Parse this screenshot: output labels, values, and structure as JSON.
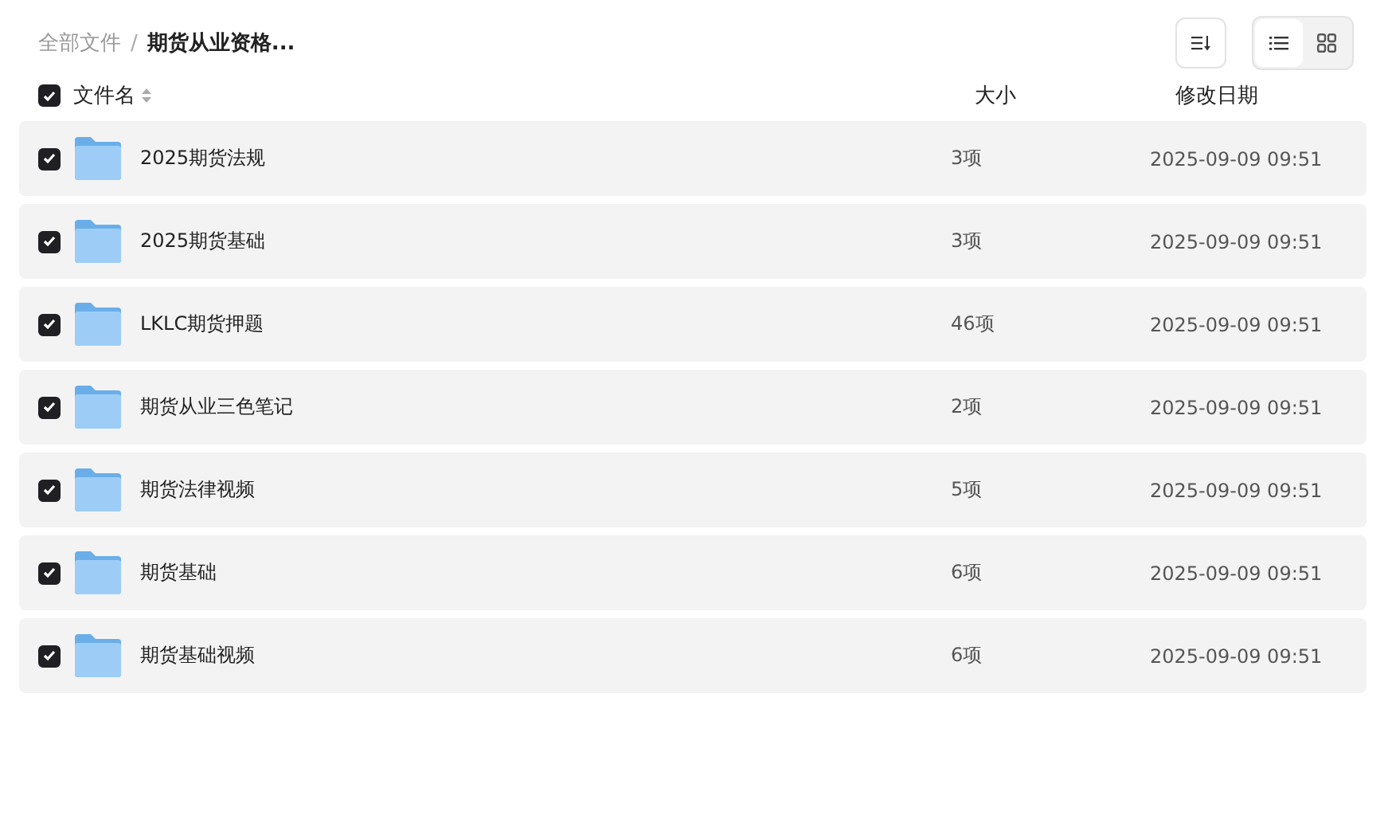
{
  "breadcrumb": [
    {
      "label": "全部文件",
      "current": false
    },
    {
      "label": "期货从业资格...",
      "current": true
    }
  ],
  "breadcrumb_separator": "/",
  "view_modes": [
    {
      "kind": "list",
      "selected": true
    },
    {
      "kind": "grid",
      "selected": false
    }
  ],
  "header": {
    "checked": true,
    "columns": [
      "文件名",
      "大小",
      "修改日期"
    ]
  },
  "rows": [
    {
      "name": "2025期货法规",
      "size": "3项",
      "modified": "2025-09-09 09:51",
      "checked": true
    },
    {
      "name": "2025期货基础",
      "size": "3项",
      "modified": "2025-09-09 09:51",
      "checked": true
    },
    {
      "name": "LKLC期货押题",
      "size": "46项",
      "modified": "2025-09-09 09:51",
      "checked": true
    },
    {
      "name": "期货从业三色笔记",
      "size": "2项",
      "modified": "2025-09-09 09:51",
      "checked": true
    },
    {
      "name": "期货法律视频",
      "size": "5项",
      "modified": "2025-09-09 09:51",
      "checked": true
    },
    {
      "name": "期货基础",
      "size": "6项",
      "modified": "2025-09-09 09:51",
      "checked": true
    },
    {
      "name": "期货基础视频",
      "size": "6项",
      "modified": "2025-09-09 09:51",
      "checked": true
    }
  ]
}
